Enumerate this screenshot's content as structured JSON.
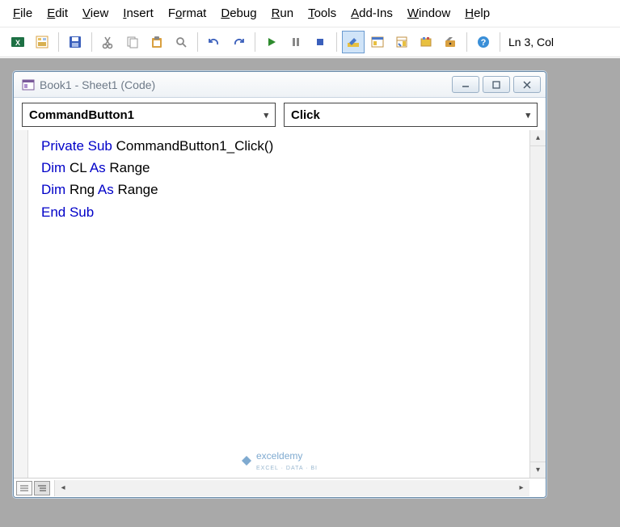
{
  "menu": {
    "file": "File",
    "edit": "Edit",
    "view": "View",
    "insert": "Insert",
    "format": "Format",
    "debug": "Debug",
    "run": "Run",
    "tools": "Tools",
    "addins": "Add-Ins",
    "window": "Window",
    "help": "Help"
  },
  "status": {
    "pos": "Ln 3, Col"
  },
  "window": {
    "title": "Book1 - Sheet1 (Code)"
  },
  "dropdowns": {
    "object": "CommandButton1",
    "proc": "Click"
  },
  "code": {
    "line1": {
      "kw1": "Private Sub",
      "rest": " CommandButton1_Click()"
    },
    "line2": {
      "kw1": "Dim",
      "v": " CL ",
      "kw2": "As",
      "rest": " Range"
    },
    "line3": {
      "kw1": "Dim",
      "v": " Rng ",
      "kw2": "As",
      "rest": " Range"
    },
    "line4": {
      "kw1": "End Sub"
    }
  },
  "watermark": {
    "main": "exceldemy",
    "sub": "EXCEL · DATA · BI"
  }
}
